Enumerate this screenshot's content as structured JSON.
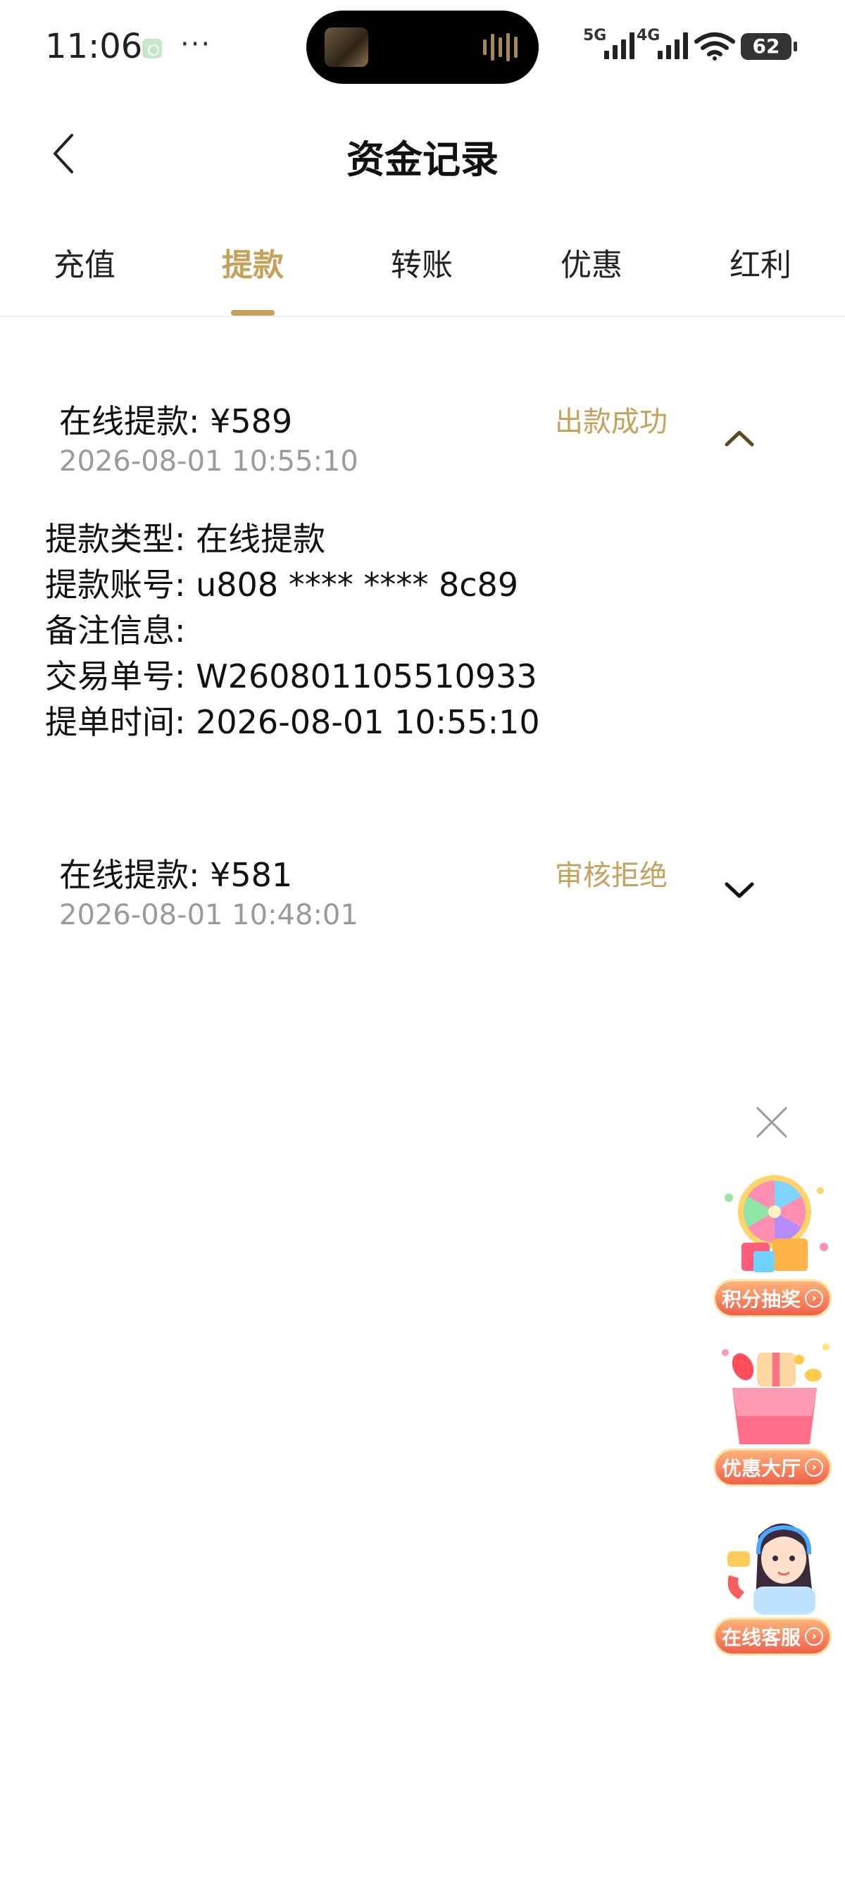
{
  "status_bar": {
    "time": "11:06",
    "more": "···",
    "network1": "5G",
    "network2": "4G",
    "battery": "62"
  },
  "header": {
    "title": "资金记录",
    "back_icon": "chevron-left-icon"
  },
  "tabs": {
    "items": [
      {
        "label": "充值"
      },
      {
        "label": "提款"
      },
      {
        "label": "转账"
      },
      {
        "label": "优惠"
      },
      {
        "label": "红利"
      }
    ],
    "active": "提款",
    "accent_color": "#c6a15b"
  },
  "records": [
    {
      "title": "在线提款: ¥589",
      "time": "2026-08-01 10:55:10",
      "status": "出款成功",
      "expanded": true,
      "details": [
        {
          "label": "提款类型:",
          "value": "在线提款"
        },
        {
          "label": "提款账号:",
          "value": "u808 **** **** 8c89"
        },
        {
          "label": "备注信息:",
          "value": ""
        },
        {
          "label": "交易单号:",
          "value": "W260801105510933"
        },
        {
          "label": "提单时间:",
          "value": "2026-08-01 10:55:10"
        }
      ]
    },
    {
      "title": "在线提款: ¥581",
      "time": "2026-08-01 10:48:01",
      "status": "审核拒绝",
      "expanded": false
    }
  ],
  "floating": {
    "close_icon": "close-icon",
    "promos": [
      {
        "label": "积分抽奖",
        "icon": "prize-wheel-icon"
      },
      {
        "label": "优惠大厅",
        "icon": "gift-box-icon"
      },
      {
        "label": "在线客服",
        "icon": "customer-service-icon"
      }
    ]
  }
}
